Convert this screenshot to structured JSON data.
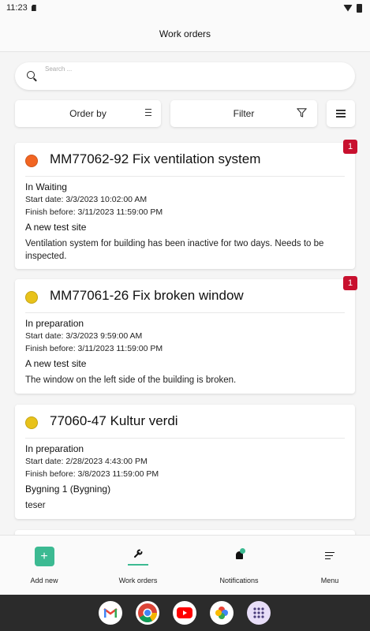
{
  "status_bar": {
    "time": "11:23"
  },
  "header": {
    "title": "Work orders"
  },
  "search": {
    "placeholder": "Search ..."
  },
  "toolbar": {
    "order_by_label": "Order by",
    "filter_label": "Filter"
  },
  "colors": {
    "accent": "#3cba92",
    "badge": "#c8102e",
    "status_orange": "#f26522",
    "status_yellow": "#e8c21a"
  },
  "work_orders": [
    {
      "title": "MM77062-92 Fix ventilation system",
      "status_color": "#f26522",
      "badge": "1",
      "status": "In Waiting",
      "start": "Start date: 3/3/2023 10:02:00 AM",
      "finish": "Finish before: 3/11/2023 11:59:00 PM",
      "site": "A new test site",
      "description": "Ventilation system for building has been inactive for two days. Needs to be inspected."
    },
    {
      "title": "MM77061-26 Fix broken window",
      "status_color": "#e8c21a",
      "badge": "1",
      "status": "In preparation",
      "start": "Start date: 3/3/2023 9:59:00 AM",
      "finish": "Finish before: 3/11/2023 11:59:00 PM",
      "site": "A new test site",
      "description": "The window on the left side of the building is broken."
    },
    {
      "title": "77060-47 Kultur verdi",
      "status_color": "#e8c21a",
      "badge": "",
      "status": "In preparation",
      "start": "Start date: 2/28/2023 4:43:00 PM",
      "finish": "Finish before: 3/8/2023 11:59:00 PM",
      "site": "Bygning 1 (Bygning)",
      "description": "teser"
    }
  ],
  "bottom_nav": {
    "add_new": "Add new",
    "work_orders": "Work orders",
    "notifications": "Notifications",
    "menu": "Menu"
  },
  "dock": {
    "apps": [
      "gmail-icon",
      "chrome-icon",
      "youtube-icon",
      "photos-icon",
      "app-drawer-icon"
    ]
  }
}
